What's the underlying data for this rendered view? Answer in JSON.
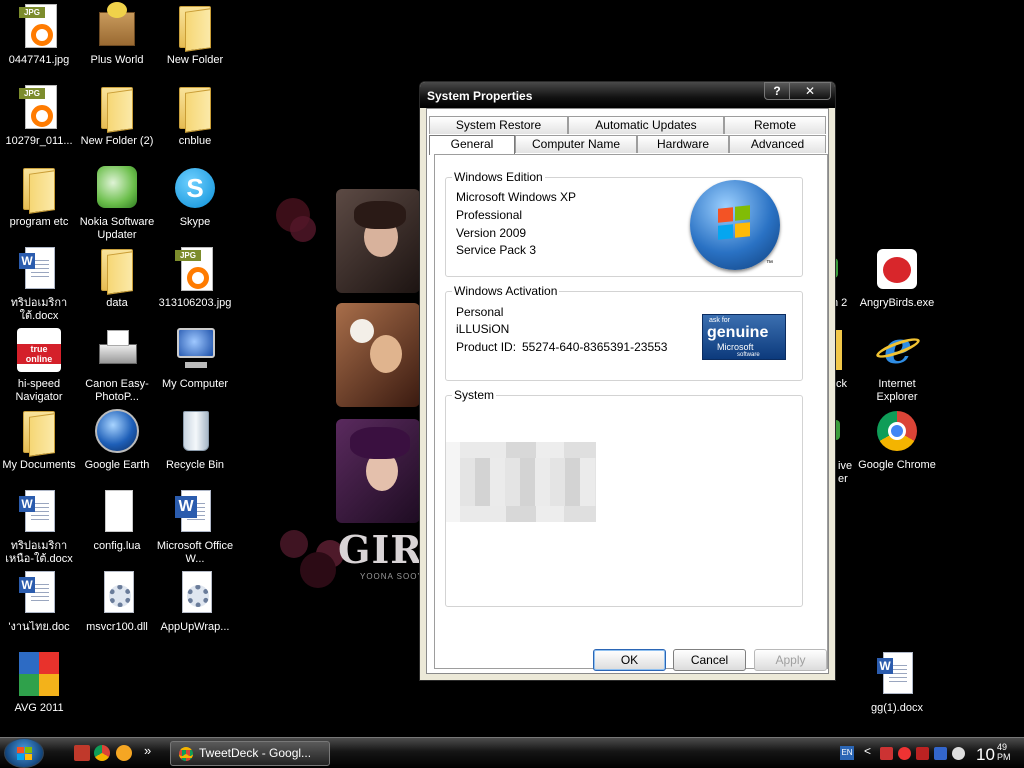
{
  "desktop": {
    "icons": [
      {
        "label": "0447741.jpg"
      },
      {
        "label": "Plus World"
      },
      {
        "label": "New Folder"
      },
      {
        "label": "10279r_011..."
      },
      {
        "label": "New Folder (2)"
      },
      {
        "label": "cnblue"
      },
      {
        "label": "program etc"
      },
      {
        "label": "Nokia Software Updater"
      },
      {
        "label": "Skype"
      },
      {
        "label": "ทริปอเมริกาใต้.docx"
      },
      {
        "label": "data"
      },
      {
        "label": "313106203.jpg"
      },
      {
        "label": "hi-speed Navigator"
      },
      {
        "label": "Canon Easy-PhotoP..."
      },
      {
        "label": "My Computer"
      },
      {
        "label": "My Documents"
      },
      {
        "label": "Google Earth"
      },
      {
        "label": "Recycle Bin"
      },
      {
        "label": "ทริปอเมริกาเหนือ-ใต้.docx"
      },
      {
        "label": "config.lua"
      },
      {
        "label": "Microsoft Office W..."
      },
      {
        "label": "'งานไทย.doc"
      },
      {
        "label": "msvcr100.dll"
      },
      {
        "label": "AppUpWrap..."
      },
      {
        "label": "AVG 2011"
      },
      {
        "label": "AngryBirds.exe"
      },
      {
        "label": "Internet Explorer"
      },
      {
        "label": "Google Chrome"
      },
      {
        "label": "gg(1).docx"
      }
    ],
    "partial_labels": {
      "a": "n 2",
      "b": "ck",
      "c": "ive",
      "d": "er"
    },
    "wallpaper": {
      "title": "GIRL",
      "subtitle": "YOONA SOOYOU"
    },
    "icon_text": {
      "jpg_tag": "JPG",
      "word_letter": "W",
      "truemove": "true online"
    }
  },
  "window": {
    "title": "System Properties",
    "help_label": "?",
    "close_label": "✕",
    "tabs_row1": [
      "System Restore",
      "Automatic Updates",
      "Remote"
    ],
    "tabs_row2": [
      "General",
      "Computer Name",
      "Hardware",
      "Advanced"
    ],
    "active_tab": "General",
    "edition": {
      "label": "Windows Edition",
      "lines": [
        "Microsoft Windows XP",
        "Professional",
        "Version 2009",
        "Service Pack 3"
      ],
      "tm": "™"
    },
    "activation": {
      "label": "Windows Activation",
      "user": "Personal",
      "org": "iLLUSiON",
      "product_id_label": "Product ID:",
      "product_id": "55274-640-8365391-23553",
      "badge": {
        "top": "ask for",
        "main": "genuine",
        "brand": "Microsoft",
        "small": "software"
      }
    },
    "system": {
      "label": "System"
    },
    "buttons": {
      "ok": "OK",
      "cancel": "Cancel",
      "apply": "Apply"
    }
  },
  "taskbar": {
    "task_label": "TweetDeck - Googl...",
    "overflow": "»",
    "lang": "EN",
    "tray_arrow": "<",
    "clock_hour": "10",
    "clock_minute": "49",
    "clock_ampm": "PM"
  },
  "colors": {
    "title_bar": "#000000",
    "window_face": "#ece9d8",
    "accent_blue": "#2a72c4"
  }
}
